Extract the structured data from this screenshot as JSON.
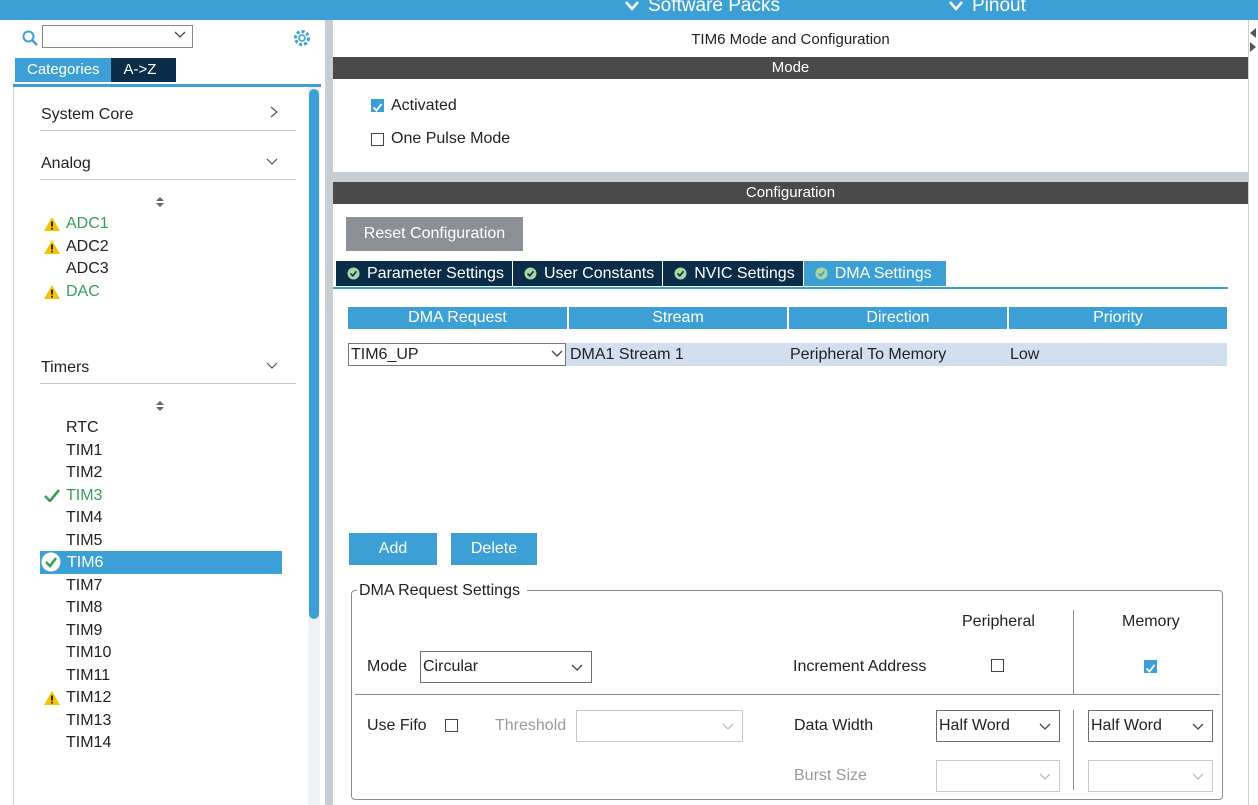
{
  "topbar": {
    "nav_software_packs": "Software Packs",
    "nav_pinout": "Pinout"
  },
  "left": {
    "search_value": "",
    "tab_categories": "Categories",
    "tab_az": "A->Z",
    "categories": [
      {
        "label": "System Core"
      },
      {
        "label": "Analog"
      },
      {
        "label": "Timers"
      }
    ],
    "analog_items": [
      {
        "label": "ADC1",
        "status": "warning"
      },
      {
        "label": "ADC2",
        "status": "warning"
      },
      {
        "label": "ADC3",
        "status": "none"
      },
      {
        "label": "DAC",
        "status": "warning"
      }
    ],
    "timer_items": [
      {
        "label": "RTC",
        "status": "none"
      },
      {
        "label": "TIM1",
        "status": "none"
      },
      {
        "label": "TIM2",
        "status": "none"
      },
      {
        "label": "TIM3",
        "status": "ok"
      },
      {
        "label": "TIM4",
        "status": "none"
      },
      {
        "label": "TIM5",
        "status": "none"
      },
      {
        "label": "TIM6",
        "status": "selected"
      },
      {
        "label": "TIM7",
        "status": "none"
      },
      {
        "label": "TIM8",
        "status": "none"
      },
      {
        "label": "TIM9",
        "status": "none"
      },
      {
        "label": "TIM10",
        "status": "none"
      },
      {
        "label": "TIM11",
        "status": "none"
      },
      {
        "label": "TIM12",
        "status": "warning"
      },
      {
        "label": "TIM13",
        "status": "none"
      },
      {
        "label": "TIM14",
        "status": "none"
      }
    ]
  },
  "main": {
    "title": "TIM6 Mode and Configuration",
    "mode_band": "Mode",
    "activated_label": "Activated",
    "activated_checked": true,
    "one_pulse_label": "One Pulse Mode",
    "one_pulse_checked": false,
    "config_band": "Configuration",
    "reset_button": "Reset Configuration",
    "tabs": [
      {
        "label": "Parameter Settings",
        "active": false
      },
      {
        "label": "User Constants",
        "active": false
      },
      {
        "label": "NVIC Settings",
        "active": false
      },
      {
        "label": "DMA Settings",
        "active": true
      }
    ],
    "dma_table": {
      "headers": [
        "DMA Request",
        "Stream",
        "Direction",
        "Priority"
      ],
      "rows": [
        {
          "request": "TIM6_UP",
          "stream": "DMA1 Stream 1",
          "direction": "Peripheral To Memory",
          "priority": "Low"
        }
      ]
    },
    "add_button": "Add",
    "delete_button": "Delete",
    "settings": {
      "legend": "DMA Request Settings",
      "peripheral_header": "Peripheral",
      "memory_header": "Memory",
      "mode_label": "Mode",
      "mode_value": "Circular",
      "increment_label": "Increment Address",
      "increment_peripheral": false,
      "increment_memory": true,
      "use_fifo_label": "Use Fifo",
      "use_fifo_checked": false,
      "threshold_label": "Threshold",
      "threshold_value": "",
      "data_width_label": "Data Width",
      "data_width_peripheral": "Half Word",
      "data_width_memory": "Half Word",
      "burst_size_label": "Burst Size",
      "burst_peripheral": "",
      "burst_memory": ""
    }
  },
  "colors": {
    "accent": "#3ca0d6",
    "dark_navy": "#0c2d49",
    "band_dark": "#4a4a4a",
    "warning": "#f5c400",
    "ok_green": "#3a9e5b"
  }
}
